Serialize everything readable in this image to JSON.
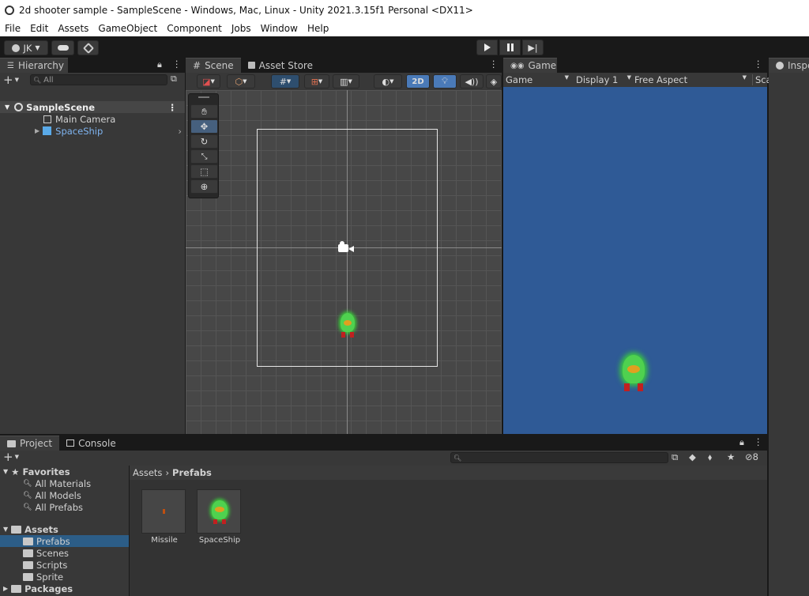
{
  "window": {
    "title": "2d shooter sample - SampleScene - Windows, Mac, Linux - Unity 2021.3.15f1 Personal <DX11>"
  },
  "menu": [
    "File",
    "Edit",
    "Assets",
    "GameObject",
    "Component",
    "Jobs",
    "Window",
    "Help"
  ],
  "toolbar": {
    "account": "JK"
  },
  "hierarchy": {
    "tab": "Hierarchy",
    "search_placeholder": "All",
    "scene": "SampleScene",
    "items": [
      "Main Camera",
      "SpaceShip"
    ]
  },
  "scene": {
    "tab": "Scene",
    "asset_store_tab": "Asset Store",
    "mode_2d": "2D"
  },
  "game": {
    "tab": "Game",
    "mode": "Game",
    "display": "Display 1",
    "aspect": "Free Aspect",
    "scale": "Sca"
  },
  "inspector": {
    "tab": "Inspe"
  },
  "project": {
    "tab": "Project",
    "console_tab": "Console",
    "favorites": "Favorites",
    "fav_items": [
      "All Materials",
      "All Models",
      "All Prefabs"
    ],
    "assets": "Assets",
    "asset_folders": [
      "Prefabs",
      "Scenes",
      "Scripts",
      "Sprite"
    ],
    "packages": "Packages",
    "breadcrumb_root": "Assets",
    "breadcrumb_current": "Prefabs",
    "hidden_count": "8",
    "grid_items": [
      "Missile",
      "SpaceShip"
    ]
  },
  "colors": {
    "game_bg": "#2f5a96",
    "selection": "#2c5d87",
    "accent": "#4a7ab8"
  }
}
